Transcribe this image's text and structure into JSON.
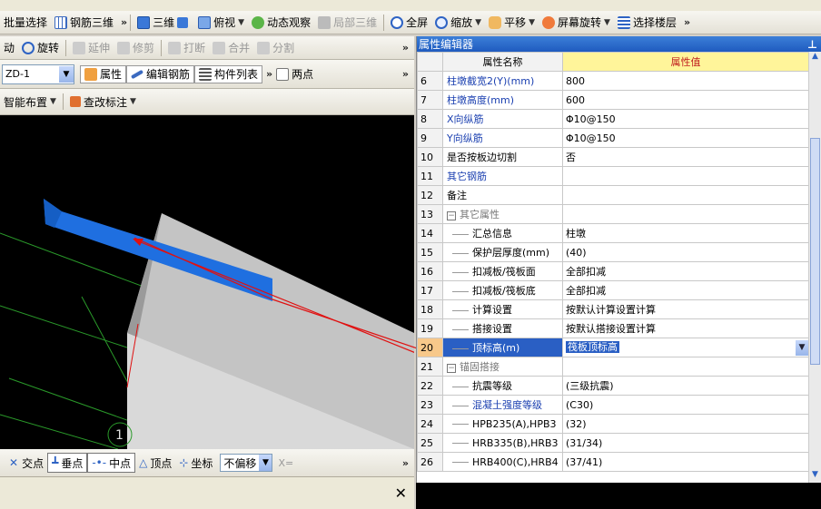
{
  "toolbar1": {
    "batch_select": "批量选择",
    "rebar_3d": "钢筋三维",
    "view_3d": "三维",
    "top_view": "俯视",
    "dynamic_observe": "动态观察",
    "local_3d": "局部三维",
    "fullscreen": "全屏",
    "zoom": "缩放",
    "pan": "平移",
    "screen_rotate": "屏幕旋转",
    "select_floor": "选择楼层"
  },
  "toolbar2": {
    "move": "动",
    "rotate": "旋转",
    "extend": "延伸",
    "trim": "修剪",
    "break": "打断",
    "merge": "合并",
    "split": "分割"
  },
  "toolbar3": {
    "component_select": "ZD-1",
    "properties": "属性",
    "edit_rebar": "编辑钢筋",
    "component_list": "构件列表",
    "two_points": "两点"
  },
  "toolbar4": {
    "smart_layout": "智能布置",
    "check_label": "查改标注"
  },
  "snap_bar": {
    "intersection": "交点",
    "perpendicular": "垂点",
    "midpoint": "中点",
    "vertex": "顶点",
    "coordinate": "坐标",
    "offset": "不偏移",
    "x_label": "X="
  },
  "canvas": {
    "axis_label": "1"
  },
  "panel": {
    "title": "属性编辑器",
    "pin": "ᵖ",
    "col_name": "属性名称",
    "col_value": "属性值",
    "rows": [
      {
        "no": "6",
        "name": "柱墩截宽2(Y)(mm)",
        "value": "800",
        "style": "blue",
        "indent": 0
      },
      {
        "no": "7",
        "name": "柱墩高度(mm)",
        "value": "600",
        "style": "blue",
        "indent": 0
      },
      {
        "no": "8",
        "name": "X向纵筋",
        "value": "Φ10@150",
        "style": "blue",
        "indent": 0
      },
      {
        "no": "9",
        "name": "Y向纵筋",
        "value": "Φ10@150",
        "style": "blue",
        "indent": 0
      },
      {
        "no": "10",
        "name": "是否按板边切割",
        "value": "否",
        "style": "",
        "indent": 0
      },
      {
        "no": "11",
        "name": "其它钢筋",
        "value": "",
        "style": "blue",
        "indent": 0
      },
      {
        "no": "12",
        "name": "备注",
        "value": "",
        "style": "",
        "indent": 0
      },
      {
        "no": "13",
        "name": "其它属性",
        "value": "",
        "style": "gray",
        "indent": 0,
        "group": "−"
      },
      {
        "no": "14",
        "name": "汇总信息",
        "value": "柱墩",
        "style": "",
        "indent": 1
      },
      {
        "no": "15",
        "name": "保护层厚度(mm)",
        "value": "(40)",
        "style": "",
        "indent": 1
      },
      {
        "no": "16",
        "name": "扣减板/筏板面",
        "value": "全部扣减",
        "style": "",
        "indent": 1
      },
      {
        "no": "17",
        "name": "扣减板/筏板底",
        "value": "全部扣减",
        "style": "",
        "indent": 1
      },
      {
        "no": "18",
        "name": "计算设置",
        "value": "按默认计算设置计算",
        "style": "",
        "indent": 1
      },
      {
        "no": "19",
        "name": "搭接设置",
        "value": "按默认搭接设置计算",
        "style": "",
        "indent": 1
      },
      {
        "no": "20",
        "name": "顶标高(m)",
        "value": "筏板顶标高",
        "style": "selected",
        "indent": 1
      },
      {
        "no": "21",
        "name": "锚固搭接",
        "value": "",
        "style": "gray",
        "indent": 0,
        "group": "−"
      },
      {
        "no": "22",
        "name": "抗震等级",
        "value": "(三级抗震)",
        "style": "",
        "indent": 1
      },
      {
        "no": "23",
        "name": "混凝土强度等级",
        "value": "(C30)",
        "style": "blue",
        "indent": 1
      },
      {
        "no": "24",
        "name": "HPB235(A),HPB3",
        "value": "(32)",
        "style": "",
        "indent": 1
      },
      {
        "no": "25",
        "name": "HRB335(B),HRB3",
        "value": "(31/34)",
        "style": "",
        "indent": 1
      },
      {
        "no": "26",
        "name": "HRB400(C),HRB4",
        "value": "(37/41)",
        "style": "",
        "indent": 1
      }
    ]
  },
  "colors": {
    "panel_title": "#2a63c9",
    "highlight_red": "#e01010",
    "selected_row": "#2a5fc4",
    "value_header": "#fff59a",
    "model_blue": "#1f6fe0",
    "model_gray": "#c4c4c4"
  }
}
